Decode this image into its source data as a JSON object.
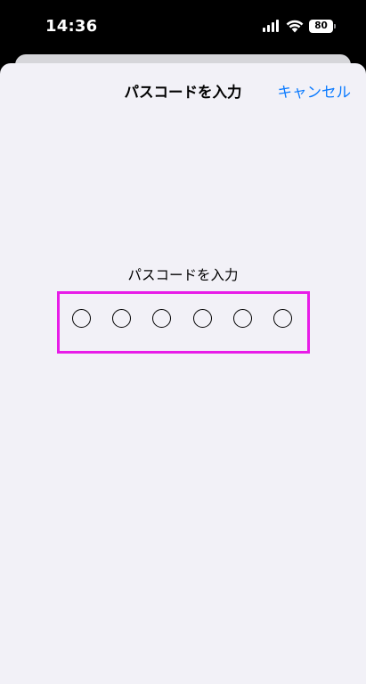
{
  "status_bar": {
    "time": "14:36",
    "battery_level": "80",
    "icons": [
      "signal-icon",
      "wifi-icon",
      "battery-icon"
    ]
  },
  "sheet": {
    "title": "パスコードを入力",
    "cancel_label": "キャンセル",
    "prompt": "パスコードを入力",
    "passcode_length": 6,
    "entered_digits": 0
  },
  "colors": {
    "accent": "#0a7aff",
    "sheet_background": "#f2f1f7",
    "highlight": "#e81ce8"
  }
}
